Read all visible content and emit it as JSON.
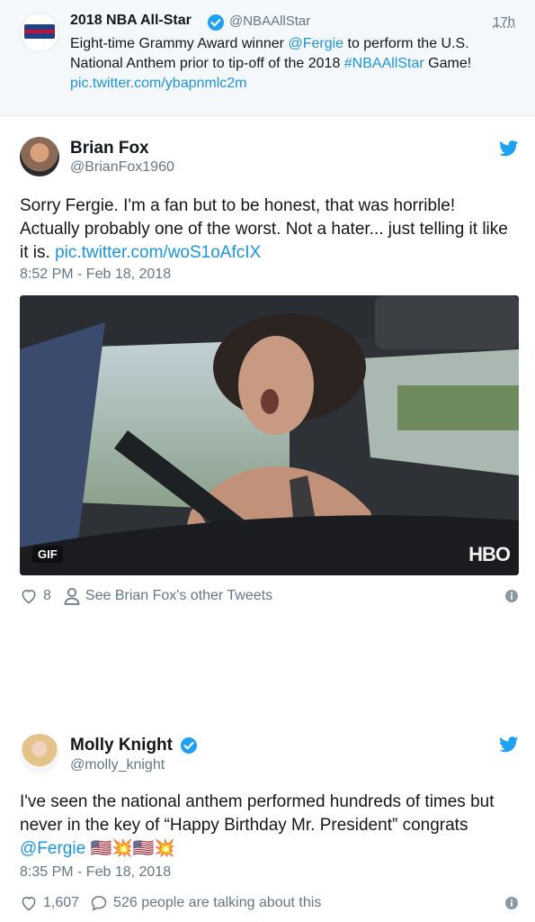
{
  "quoted_tweet": {
    "name": "2018 NBA All-Star",
    "handle": "@NBAAllStar",
    "time": "17h",
    "text_1": "Eight-time Grammy Award winner ",
    "mention": "@Fergie",
    "text_2": " to perform the U.S. National Anthem prior to tip-off of the 2018 ",
    "hashtag": "#NBAAllStar",
    "text_3": " Game! ",
    "link": "pic.twitter.com/ybapnmlc2m"
  },
  "tweet1": {
    "name": "Brian Fox",
    "handle": "@BrianFox1960",
    "text": "Sorry Fergie.  I'm a fan but to be honest,  that was horrible!  Actually probably one of the worst.  Not a hater... just telling it like it is. ",
    "link": "pic.twitter.com/woS1oAfcIX",
    "timestamp": "8:52 PM - Feb 18, 2018",
    "media_badge": "GIF",
    "media_watermark": "HBO",
    "likes": "8",
    "other_tweets": "See Brian Fox's other Tweets"
  },
  "tweet2": {
    "name": "Molly Knight",
    "handle": "@molly_knight",
    "text": "I've seen the national anthem performed hundreds of times but never in the key of “Happy Birthday Mr. President” congrats ",
    "mention": "@Fergie",
    "emoji": "🇺🇸💥🇺🇸💥",
    "timestamp": "8:35 PM - Feb 18, 2018",
    "likes": "1,607",
    "talking": "526 people are talking about this"
  },
  "colors": {
    "link": "#1b95e0",
    "secondary_text": "#657786",
    "twitter_blue": "#1da1f2",
    "quoted_bg": "#f5f8fa"
  },
  "icons": [
    "verified-badge-icon",
    "twitter-bird-icon",
    "heart-icon",
    "person-icon",
    "speech-bubble-icon",
    "info-icon"
  ]
}
